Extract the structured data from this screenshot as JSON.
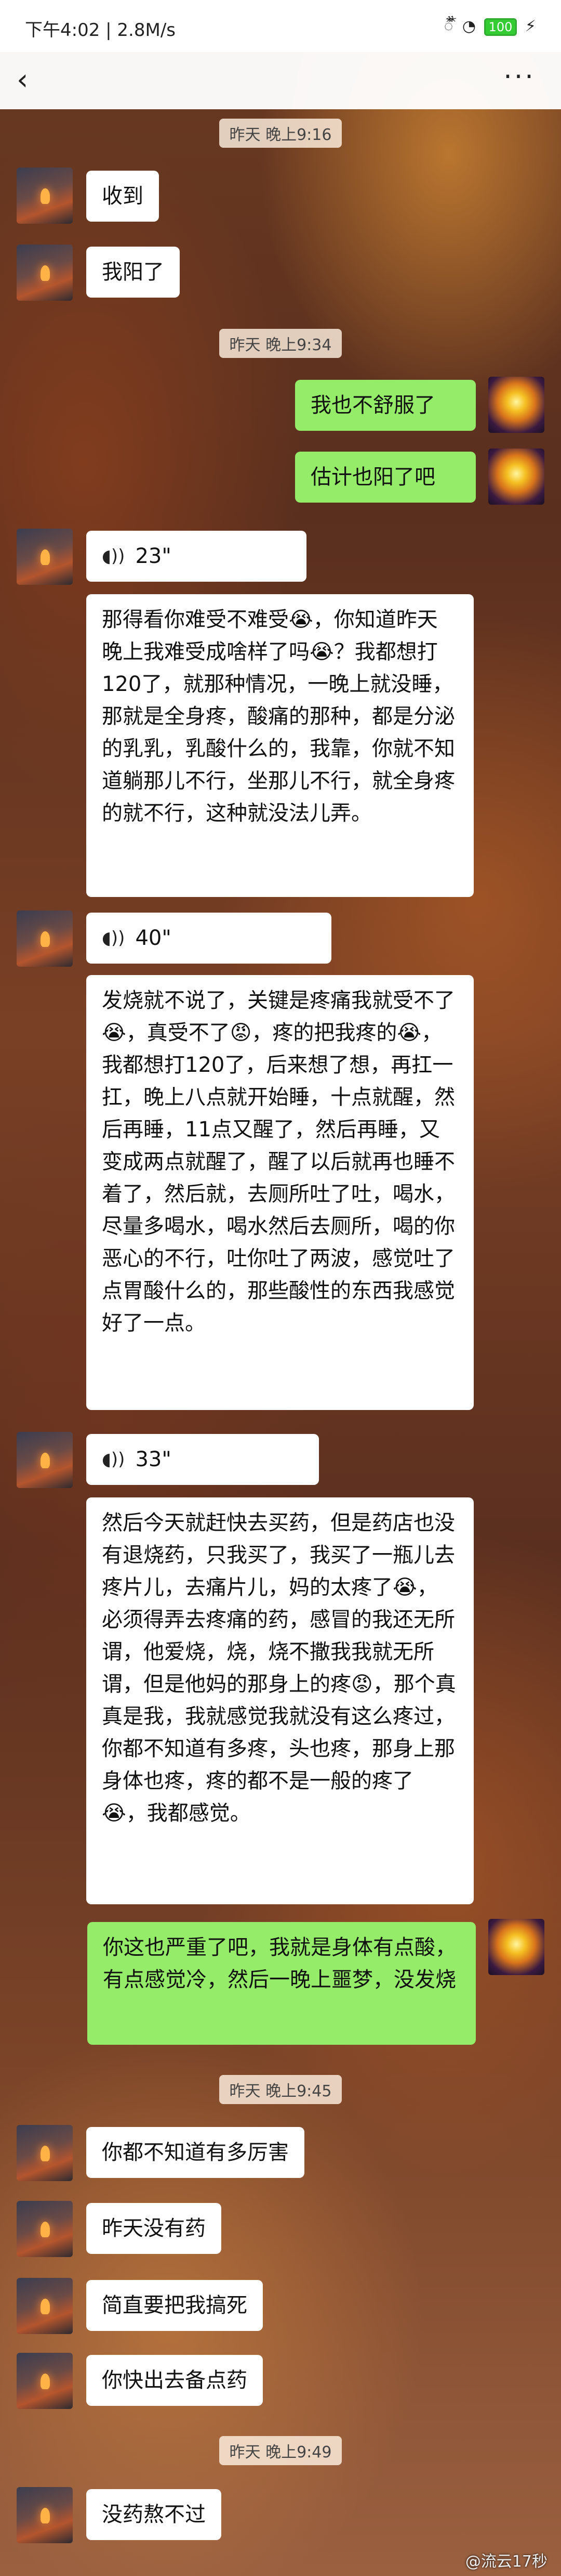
{
  "statusbar": {
    "time": "下午4:02 | 2.8M/s",
    "signal": "᭰ ᭰ ◔",
    "battery": "100",
    "bolt": "⚡"
  },
  "nav": {
    "back_icon": "‹",
    "more_icon": "···"
  },
  "timestamps": [
    "昨天 晚上9:16",
    "昨天 晚上9:34",
    "昨天 晚上9:45",
    "昨天 晚上9:49"
  ],
  "messages": {
    "m1": "收到",
    "m2": "我阳了",
    "m3": "我也不舒服了",
    "m4": "估计也阳了吧",
    "v1": "23\"",
    "t1": "那得看你难受不难受😭，你知道昨天晚上我难受成啥样了吗😭？我都想打120了，就那种情况，一晚上就没睡，那就是全身疼，酸痛的那种，都是分泌的乳乳，乳酸什么的，我靠，你就不知道躺那儿不行，坐那儿不行，就全身疼的就不行，这种就没法儿弄。",
    "v2": "40\"",
    "t2": "发烧就不说了，关键是疼痛我就受不了😭，真受不了😡，疼的把我疼的😭，我都想打120了，后来想了想，再扛一扛，晚上八点就开始睡，十点就醒，然后再睡，11点又醒了，然后再睡，又变成两点就醒了，醒了以后就再也睡不着了，然后就，去厕所吐了吐，喝水，尽量多喝水，喝水然后去厕所，喝的你恶心的不行，吐你吐了两波，感觉吐了点胃酸什么的，那些酸性的东西我感觉好了一点。",
    "v3": "33\"",
    "t3": "然后今天就赶快去买药，但是药店也没有退烧药，只我买了，我买了一瓶儿去疼片儿，去痛片儿，妈的太疼了😭，必须得弄去疼痛的药，感冒的我还无所谓，他爱烧，烧，烧不撒我我就无所谓，但是他妈的那身上的疼😡，那个真真是我，我就感觉我就没有这么疼过，你都不知道有多疼，头也疼，那身上那身体也疼，疼的都不是一般的疼了😭，我都感觉。",
    "m5": "你这也严重了吧，我就是身体有点酸，有点感觉冷，然后一晚上噩梦，没发烧",
    "m6": "你都不知道有多厉害",
    "m7": "昨天没有药",
    "m8": "简直要把我搞死",
    "m9": "你快出去备点药",
    "m10": "没药熬不过"
  },
  "voice_icon": "◖))",
  "watermark": "@流云17秒"
}
